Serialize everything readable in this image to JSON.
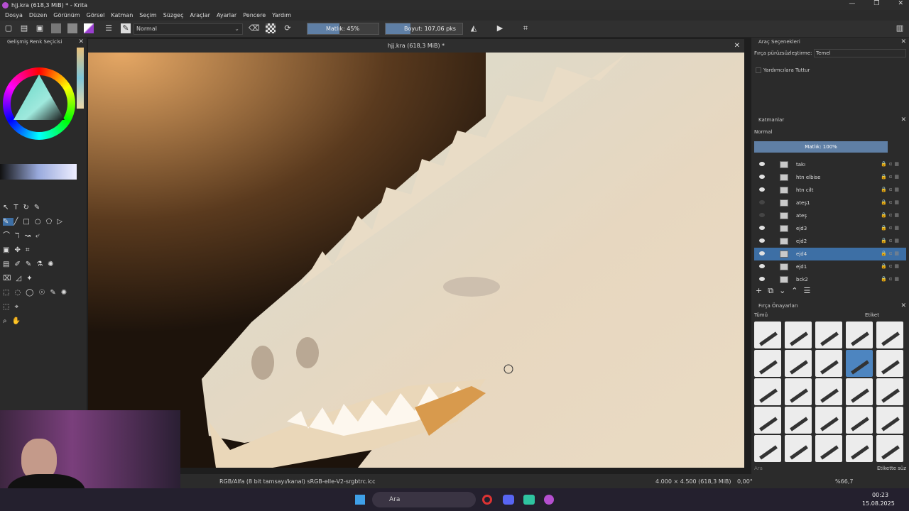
{
  "window": {
    "title": "hjj.kra (618,3 MiB) * - Krita",
    "document_tab": "hjj.kra (618,3 MiB) *"
  },
  "menu": [
    "Dosya",
    "Düzen",
    "Görünüm",
    "Görsel",
    "Katman",
    "Seçim",
    "Süzgeç",
    "Araçlar",
    "Ayarlar",
    "Pencere",
    "Yardım"
  ],
  "toolbar": {
    "blend_mode": "Normal",
    "opacity_label": "Matlık: 45%",
    "opacity": 0.45,
    "size_label": "Boyut: 107,06 pks",
    "size_fraction": 0.32
  },
  "left_panel": {
    "title": "Gelişmiş Renk Seçicisi"
  },
  "tool_options": {
    "title": "Araç Seçenekleri",
    "smoothing_label": "Fırça pürüzsüzleştirme:",
    "smoothing_value": "Temel",
    "assistant_label": "Yardımcılara Tuttur"
  },
  "layers": {
    "title": "Katmanlar",
    "blend_mode": "Normal",
    "opacity_label": "Matlık: 100%",
    "items": [
      {
        "name": "takı",
        "visible": true,
        "selected": false
      },
      {
        "name": "htn elbise",
        "visible": true,
        "selected": false
      },
      {
        "name": "htn cilt",
        "visible": true,
        "selected": false
      },
      {
        "name": "ateş1",
        "visible": false,
        "selected": false
      },
      {
        "name": "ateş",
        "visible": false,
        "selected": false
      },
      {
        "name": "ejd3",
        "visible": true,
        "selected": false
      },
      {
        "name": "ejd2",
        "visible": true,
        "selected": false
      },
      {
        "name": "ejd4",
        "visible": true,
        "selected": true
      },
      {
        "name": "ejd1",
        "visible": true,
        "selected": false
      },
      {
        "name": "bck2",
        "visible": true,
        "selected": false
      }
    ]
  },
  "brush_presets": {
    "title": "Fırça Önayarları",
    "filter": "Tümü",
    "tag_label": "Etiket",
    "search_placeholder": "Ara",
    "filter_in_tag": "Etikette süz"
  },
  "status": {
    "color_profile": "RGB/Alfa (8 bit tamsayı/kanal) sRGB-elle-V2-srgbtrc.icc",
    "dimensions": "4.000 × 4.500 (618,3 MiB)",
    "rotation": "0,00°",
    "zoom": "%66,7"
  },
  "taskbar": {
    "search": "Ara",
    "time": "00:23",
    "date": "15.08.2025"
  },
  "colors": {
    "accent": "#5f7fa5",
    "selection": "#3d6fa5",
    "brush_selected": "#4d85c0"
  }
}
